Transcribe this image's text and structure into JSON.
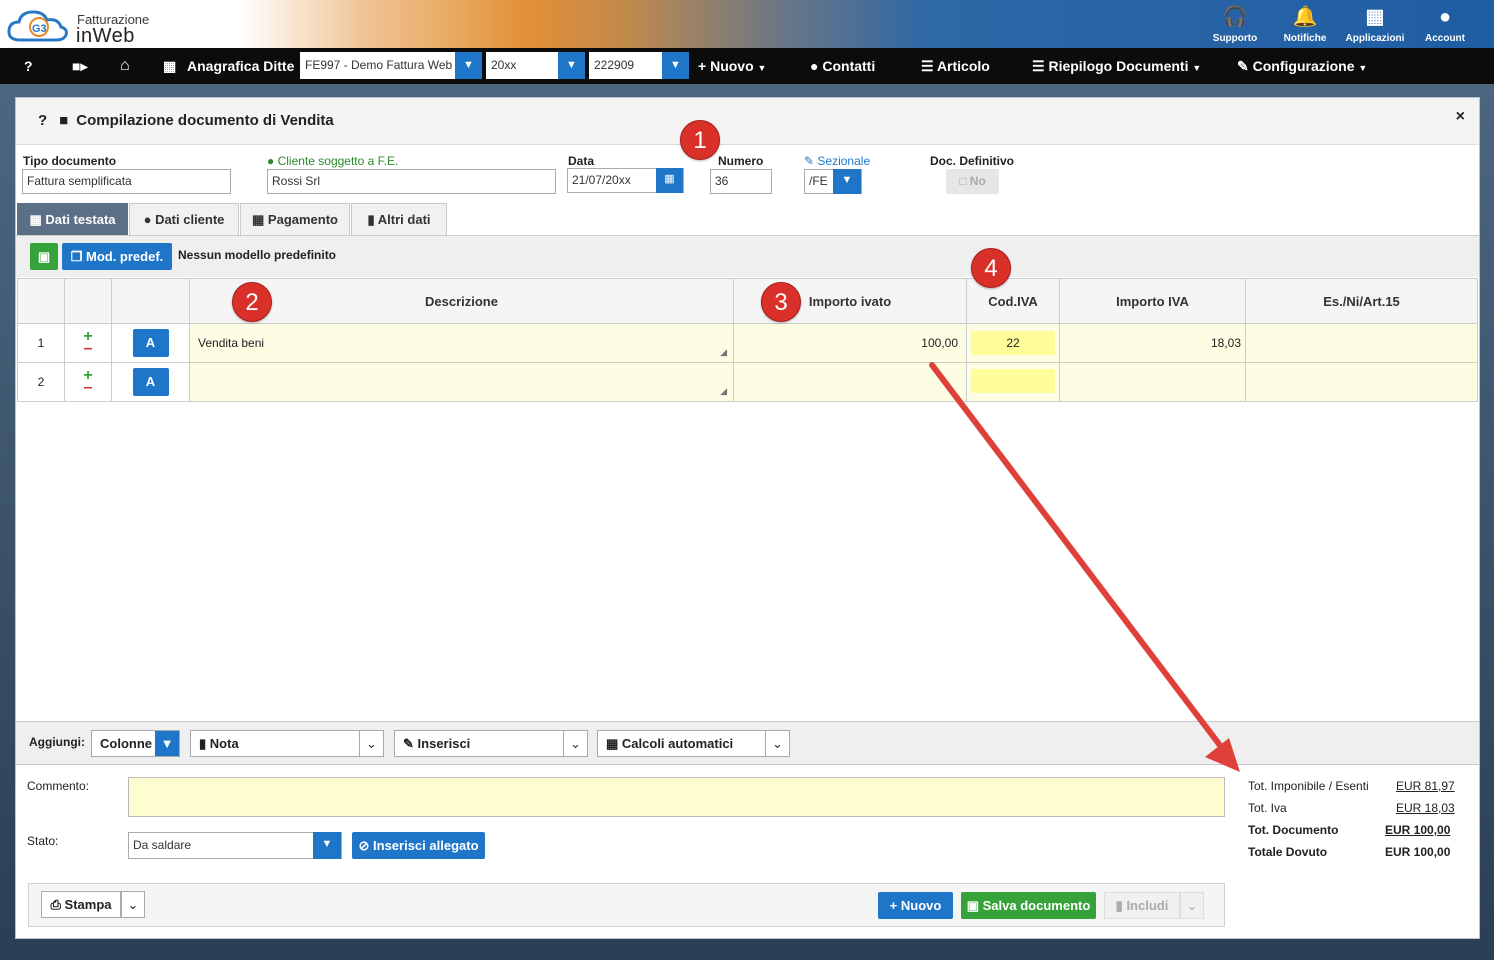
{
  "app": {
    "logo_line1": "Fatturazione",
    "logo_line2": "inWeb",
    "logo_badge": "G3"
  },
  "topnav": [
    {
      "icon": "headset-icon",
      "label": "Supporto"
    },
    {
      "icon": "bell-icon",
      "label": "Notifiche"
    },
    {
      "icon": "grid-icon",
      "label": "Applicazioni"
    },
    {
      "icon": "user-icon",
      "label": "Account"
    }
  ],
  "navbar": {
    "help": "?",
    "anagrafica": "Anagrafica Ditte",
    "company": "FE997 - Demo Fattura Web",
    "year": "20xx",
    "code": "222909",
    "nuovo": "Nuovo",
    "contatti": "Contatti",
    "articolo": "Articolo",
    "riepilogo": "Riepilogo Documenti",
    "configurazione": "Configurazione"
  },
  "modal": {
    "help": "?",
    "title": "Compilazione documento di Vendita",
    "close": "×"
  },
  "form": {
    "tipo_label": "Tipo documento",
    "tipo_value": "Fattura semplificata",
    "cliente_label": "Cliente soggetto a F.E.",
    "cliente_value": "Rossi Srl",
    "data_label": "Data",
    "data_value": "21/07/20xx",
    "numero_label": "Numero",
    "numero_value": "36",
    "sezionale_label": "Sezionale",
    "sezionale_value": "/FE",
    "def_label": "Doc. Definitivo",
    "def_value": "No"
  },
  "tabs": [
    "Dati testata",
    "Dati cliente",
    "Pagamento",
    "Altri dati"
  ],
  "toolbar": {
    "mod_label": "Mod. predef.",
    "model_text": "Nessun modello predefinito"
  },
  "badges": [
    "1",
    "2",
    "3",
    "4"
  ],
  "table": {
    "headers": [
      "Descrizione",
      "Importo ivato",
      "Cod.IVA",
      "Importo IVA",
      "Es./Ni/Art.15"
    ],
    "rows": [
      {
        "num": "1",
        "a": "A",
        "desc": "Vendita beni",
        "importo": "100,00",
        "iva": "22",
        "importo_iva": "18,03",
        "es": ""
      },
      {
        "num": "2",
        "a": "A",
        "desc": "",
        "importo": "",
        "iva": "",
        "importo_iva": "",
        "es": ""
      }
    ]
  },
  "aggiungi": {
    "label": "Aggiungi:",
    "colonne": "Colonne",
    "nota": "Nota",
    "inserisci": "Inserisci",
    "calcoli": "Calcoli automatici"
  },
  "commento_label": "Commento:",
  "stato": {
    "label": "Stato:",
    "value": "Da saldare",
    "allegato": "Inserisci allegato"
  },
  "totals": [
    {
      "label": "Tot. Imponibile / Esenti",
      "value": "EUR 81,97"
    },
    {
      "label": "Tot. Iva",
      "value": "EUR 18,03"
    },
    {
      "label": "Tot. Documento",
      "value": "EUR 100,00"
    },
    {
      "label": "Totale Dovuto",
      "value": "EUR 100,00"
    }
  ],
  "actions": {
    "stampa": "Stampa",
    "nuovo": "Nuovo",
    "salva": "Salva documento",
    "includi": "Includi"
  },
  "colors": {
    "primary": "#1f76c8",
    "success": "#35a33a",
    "badge": "#d9302a",
    "row_yellow": "#fdfde4",
    "arrow": "#e0403a"
  }
}
